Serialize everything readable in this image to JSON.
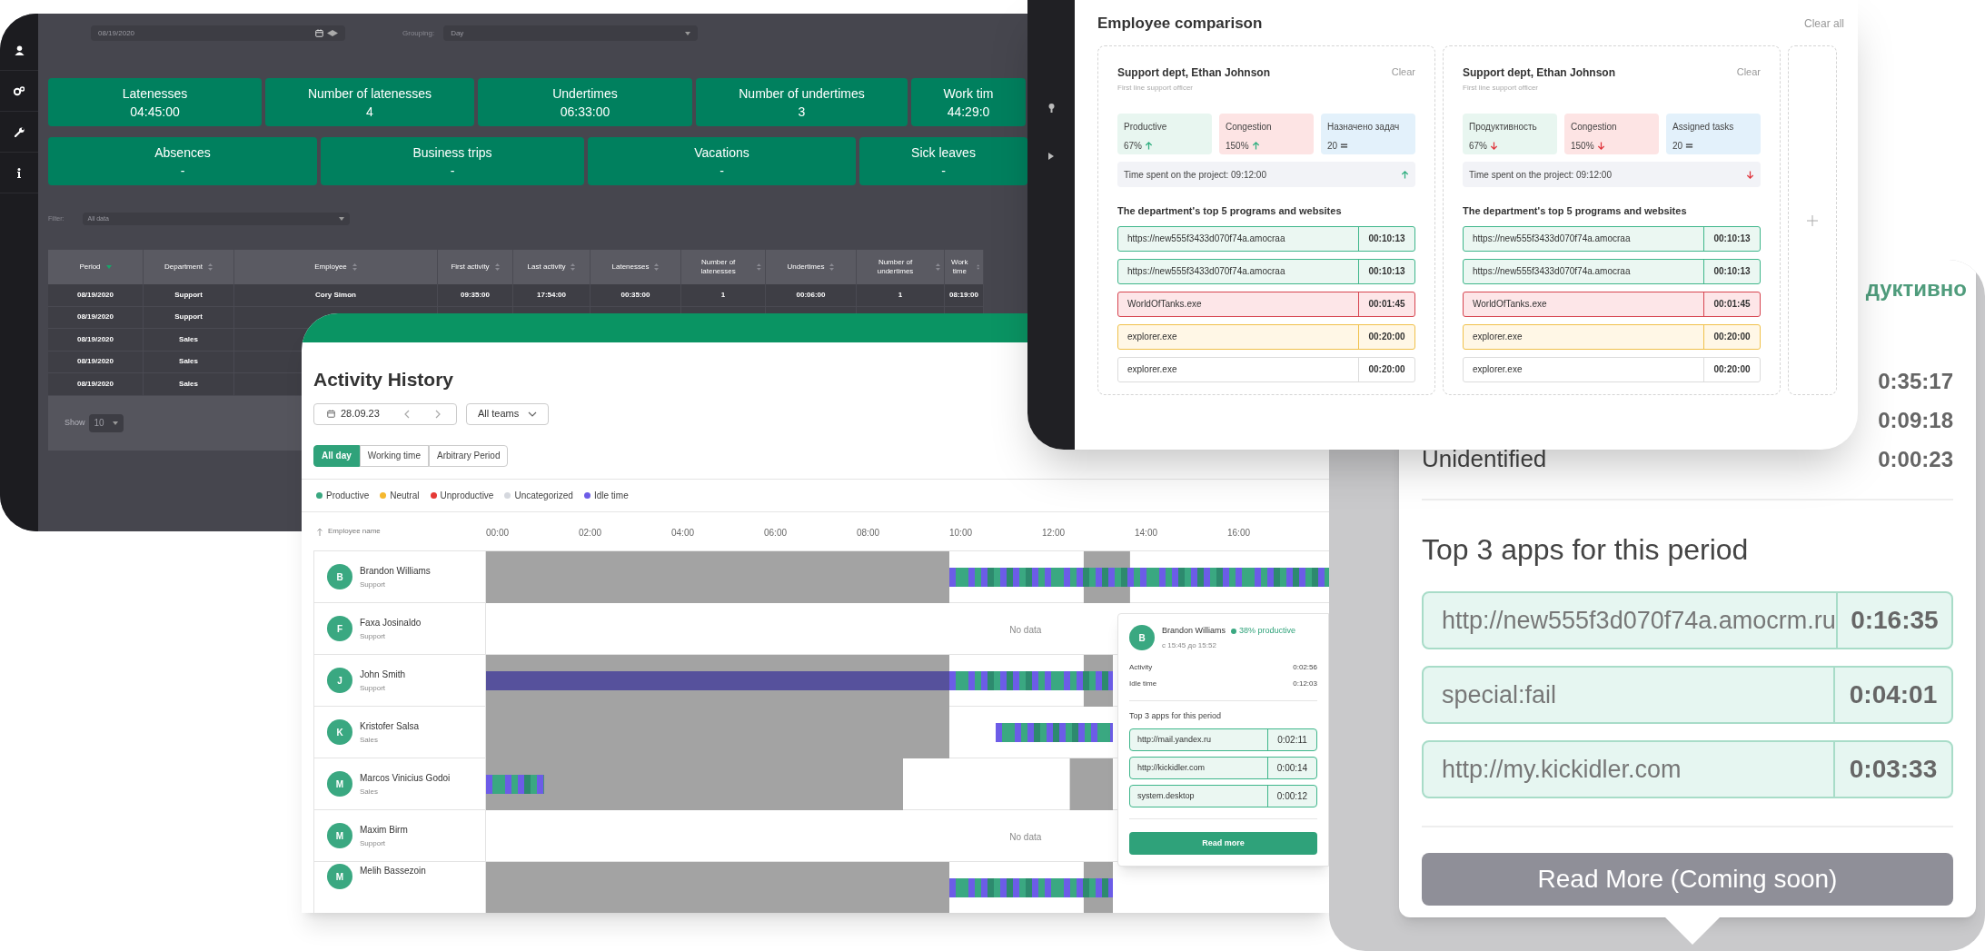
{
  "report": {
    "date": "08/19/2020",
    "grouping_label": "Grouping:",
    "grouping": "Day",
    "summary_cards": [
      {
        "label": "Latenesses",
        "value": "04:45:00"
      },
      {
        "label": "Number of latenesses",
        "value": "4"
      },
      {
        "label": "Undertimes",
        "value": "06:33:00"
      },
      {
        "label": "Number of undertimes",
        "value": "3"
      },
      {
        "label": "Work tim",
        "value": "44:29:0"
      }
    ],
    "summary_cards_2": [
      {
        "label": "Absences",
        "value": "-"
      },
      {
        "label": "Business trips",
        "value": "-"
      },
      {
        "label": "Vacations",
        "value": "-"
      },
      {
        "label": "Sick leaves",
        "value": "-"
      }
    ],
    "filter_label": "Filter:",
    "filter": "All data",
    "table": {
      "columns": [
        {
          "label": "Period",
          "sorted": true
        },
        {
          "label": "Department",
          "sorted": false
        },
        {
          "label": "Employee",
          "sorted": false
        },
        {
          "label": "First activity",
          "sorted": false
        },
        {
          "label": "Last activity",
          "sorted": false
        },
        {
          "label": "Latenesses",
          "sorted": false
        },
        {
          "label": "Number of latenesses",
          "sorted": false
        },
        {
          "label": "Undertimes",
          "sorted": false
        },
        {
          "label": "Number of undertimes",
          "sorted": false
        },
        {
          "label": "Work time",
          "sorted": false
        }
      ],
      "rows": [
        [
          "08/19/2020",
          "Support",
          "Cory Simon",
          "09:35:00",
          "17:54:00",
          "00:35:00",
          "1",
          "00:06:00",
          "1",
          "08:19:00"
        ],
        [
          "08/19/2020",
          "Support"
        ],
        [
          "08/19/2020",
          "Sales"
        ],
        [
          "08/19/2020",
          "Sales"
        ],
        [
          "08/19/2020",
          "Sales"
        ]
      ]
    },
    "show_label": "Show",
    "page_size": "10"
  },
  "activity": {
    "title": "Activity History",
    "date": "28.09.23",
    "team": "All teams",
    "periods": [
      {
        "label": "All day",
        "selected": true
      },
      {
        "label": "Working time",
        "selected": false
      },
      {
        "label": "Arbitrary Period",
        "selected": false
      }
    ],
    "legend": [
      {
        "label": "Productive",
        "color": "#3aa881"
      },
      {
        "label": "Neutral",
        "color": "#f5b82e"
      },
      {
        "label": "Unproductive",
        "color": "#e53935"
      },
      {
        "label": "Uncategorized",
        "color": "#d5d8de"
      },
      {
        "label": "Idle time",
        "color": "#6c5ce7"
      }
    ],
    "name_column": "Employee name",
    "hours": [
      "00:00",
      "02:00",
      "04:00",
      "06:00",
      "08:00",
      "10:00",
      "12:00",
      "14:00",
      "16:00"
    ],
    "employees": [
      {
        "initial": "B",
        "name": "Brandon Williams",
        "team": "Support"
      },
      {
        "initial": "F",
        "name": "Faxa Josinaldo",
        "team": "Support",
        "status_text": "No data"
      },
      {
        "initial": "J",
        "name": "John Smith",
        "team": "Support"
      },
      {
        "initial": "K",
        "name": "Kristofer Salsa",
        "team": "Sales"
      },
      {
        "initial": "M",
        "name": "Marcos Vinicius Godoi",
        "team": "Sales"
      },
      {
        "initial": "M",
        "name": "Maxim Birm",
        "team": "Support",
        "status_text": "No data"
      },
      {
        "initial": "M",
        "name": "Melih Bassezoin"
      }
    ],
    "tooltip": {
      "initial": "B",
      "name": "Brandon Williams",
      "productive": "38% productive",
      "period": "с 15:45 до 15:52",
      "stats": [
        {
          "label": "Activity",
          "value": "0:02:56"
        },
        {
          "label": "Idle time",
          "value": "0:12:03"
        }
      ],
      "apps_title": "Top 3 apps for this period",
      "apps": [
        {
          "name": "http://mail.yandex.ru",
          "time": "0:02:11"
        },
        {
          "name": "http://kickidler.com",
          "time": "0:00:14"
        },
        {
          "name": "system.desktop",
          "time": "0:00:12"
        }
      ],
      "button": "Read more"
    }
  },
  "comparison": {
    "title": "Employee comparison",
    "clear_all": "Clear all",
    "cards": [
      {
        "name": "Support dept, Ethan Johnson",
        "clear": "Clear",
        "role": "First line support officer",
        "metrics": [
          {
            "kind": "productive",
            "label": "Productive",
            "value": "67%",
            "trend": {
              "kind": "up"
            }
          },
          {
            "kind": "congestion",
            "label": "Congestion",
            "value": "150%",
            "trend": {
              "kind": "up"
            }
          },
          {
            "kind": "tasks",
            "label": "Назначено задач",
            "value": "20",
            "trend": {
              "kind": "equal"
            }
          }
        ],
        "time_spent": "Time spent on the project: 09:12:00",
        "time_trend": {
          "kind": "up"
        },
        "top_title": "The department's top 5 programs and websites",
        "programs": [
          {
            "name": "https://new555f3433d070f74a.amocraa",
            "time": "00:10:13",
            "kind": "productive"
          },
          {
            "name": "https://new555f3433d070f74a.amocraa",
            "time": "00:10:13",
            "kind": "productive"
          },
          {
            "name": "WorldOfTanks.exe",
            "time": "00:01:45",
            "kind": "unproductive"
          },
          {
            "name": "explorer.exe",
            "time": "00:20:00",
            "kind": "neutral"
          },
          {
            "name": "explorer.exe",
            "time": "00:20:00",
            "kind": "uncategorized"
          }
        ]
      },
      {
        "name": "Support dept, Ethan Johnson",
        "clear": "Clear",
        "role": "First line support officer",
        "metrics": [
          {
            "kind": "productive",
            "label": "Продуктивность",
            "value": "67%",
            "trend": {
              "kind": "down"
            }
          },
          {
            "kind": "congestion",
            "label": "Congestion",
            "value": "150%",
            "trend": {
              "kind": "down"
            }
          },
          {
            "kind": "tasks",
            "label": "Assigned tasks",
            "value": "20",
            "trend": {
              "kind": "equal"
            }
          }
        ],
        "time_spent": "Time spent on the project: 09:12:00",
        "time_trend": {
          "kind": "down"
        },
        "top_title": "The department's top 5 programs and websites",
        "programs": [
          {
            "name": "https://new555f3433d070f74a.amocraa",
            "time": "00:10:13",
            "kind": "productive"
          },
          {
            "name": "https://new555f3433d070f74a.amocraa",
            "time": "00:10:13",
            "kind": "productive"
          },
          {
            "name": "WorldOfTanks.exe",
            "time": "00:01:45",
            "kind": "unproductive"
          },
          {
            "name": "explorer.exe",
            "time": "00:20:00",
            "kind": "neutral"
          },
          {
            "name": "explorer.exe",
            "time": "00:20:00",
            "kind": "uncategorized"
          }
        ]
      }
    ]
  },
  "detail": {
    "status": "дуктивно",
    "times": [
      {
        "value": "0:35:17"
      },
      {
        "value": "0:09:18"
      },
      {
        "label": "Unidentified",
        "value": "0:00:23"
      }
    ],
    "apps_title": "Top 3 apps for this period",
    "apps": [
      {
        "name": "http://new555f3d070f74a.amocrm.ru",
        "time": "0:16:35"
      },
      {
        "name": "special:fail",
        "time": "0:04:01"
      },
      {
        "name": "http://my.kickidler.com",
        "time": "0:03:33"
      }
    ],
    "button": {
      "label": "Read More (Coming soon)",
      "disabled": true
    }
  }
}
